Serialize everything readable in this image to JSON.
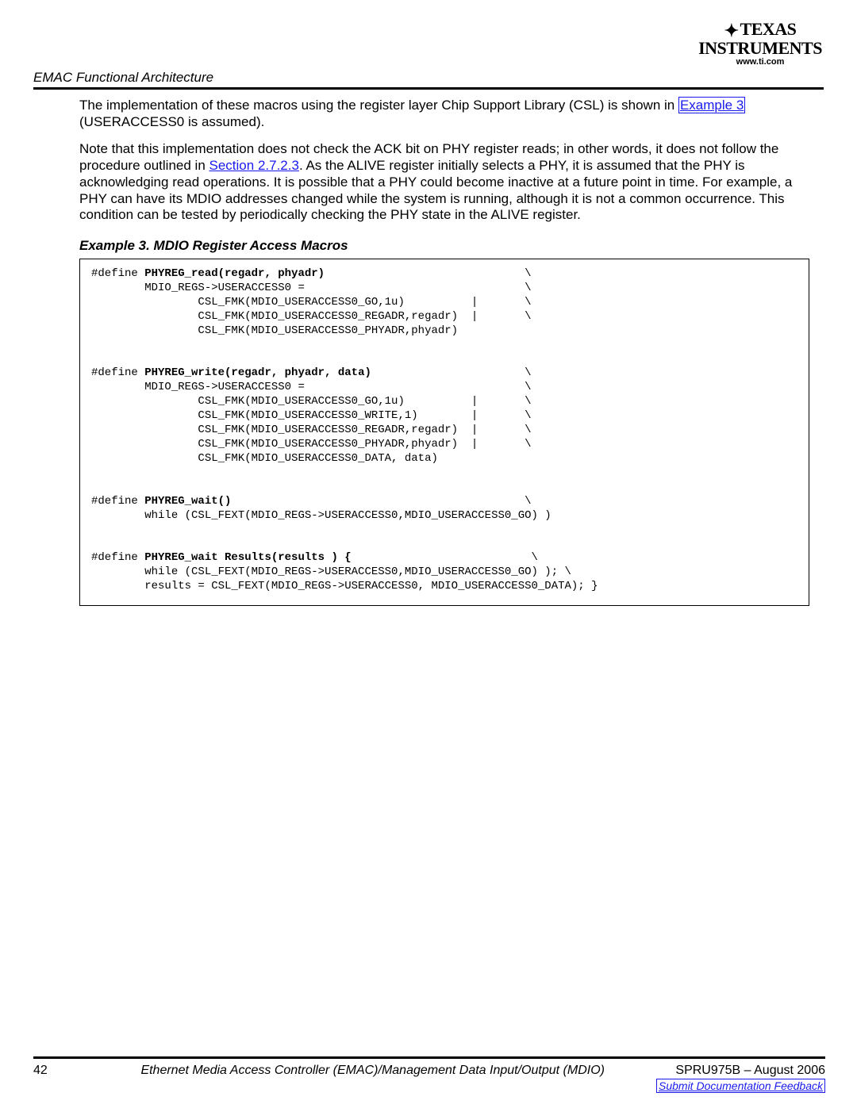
{
  "logo": {
    "row1_prefix_icon": "✦",
    "row1": "TEXAS",
    "row2": "INSTRUMENTS",
    "url": "www.ti.com"
  },
  "section_title": "EMAC Functional Architecture",
  "para1_a": "The implementation of these macros using the register layer Chip Support Library (CSL) is shown in ",
  "para1_link": "Example 3",
  "para1_b": " (USERACCESS0 is assumed).",
  "para2_a": "Note that this implementation does not check the ACK bit on PHY register reads; in other words, it does not follow the procedure outlined in ",
  "para2_link": "Section 2.7.2.3",
  "para2_b": ". As the ALIVE register initially selects a PHY, it is assumed that the PHY is acknowledging read operations. It is possible that a PHY could become inactive at a future point in time. For example, a PHY can have its MDIO addresses changed while the system is running, although it is not a common occurrence. This condition can be tested by periodically checking the PHY state in the ALIVE register.",
  "example_title": "Example 3. MDIO Register Access Macros",
  "code": {
    "m1_def": "#define ",
    "m1_sig": "PHYREG_read(regadr, phyadr)",
    "m1_pad": "                              \\",
    "m1_l1": "        MDIO_REGS->USERACCESS0 =                                 \\",
    "m1_l2": "                CSL_FMK(MDIO_USERACCESS0_GO,1u)          |       \\",
    "m1_l3": "                CSL_FMK(MDIO_USERACCESS0_REGADR,regadr)  |       \\",
    "m1_l4": "                CSL_FMK(MDIO_USERACCESS0_PHYADR,phyadr)",
    "m2_def": "#define ",
    "m2_sig": "PHYREG_write(regadr, phyadr, data)",
    "m2_pad": "                       \\",
    "m2_l1": "        MDIO_REGS->USERACCESS0 =                                 \\",
    "m2_l2": "                CSL_FMK(MDIO_USERACCESS0_GO,1u)          |       \\",
    "m2_l3": "                CSL_FMK(MDIO_USERACCESS0_WRITE,1)        |       \\",
    "m2_l4": "                CSL_FMK(MDIO_USERACCESS0_REGADR,regadr)  |       \\",
    "m2_l5": "                CSL_FMK(MDIO_USERACCESS0_PHYADR,phyadr)  |       \\",
    "m2_l6": "                CSL_FMK(MDIO_USERACCESS0_DATA, data)",
    "m3_def": "#define ",
    "m3_sig": "PHYREG_wait()",
    "m3_pad": "                                            \\",
    "m3_l1": "        while (CSL_FEXT(MDIO_REGS->USERACCESS0,MDIO_USERACCESS0_GO) )",
    "m4_def": "#define ",
    "m4_sig": "PHYREG_wait Results(results ) {",
    "m4_pad": "                           \\",
    "m4_l1": "        while (CSL_FEXT(MDIO_REGS->USERACCESS0,MDIO_USERACCESS0_GO) ); \\",
    "m4_l2": "        results = CSL_FEXT(MDIO_REGS->USERACCESS0, MDIO_USERACCESS0_DATA); }"
  },
  "footer": {
    "page": "42",
    "title": "Ethernet Media Access Controller (EMAC)/Management Data Input/Output (MDIO)",
    "docid": "SPRU975B – August 2006",
    "feedback": "Submit Documentation Feedback"
  }
}
